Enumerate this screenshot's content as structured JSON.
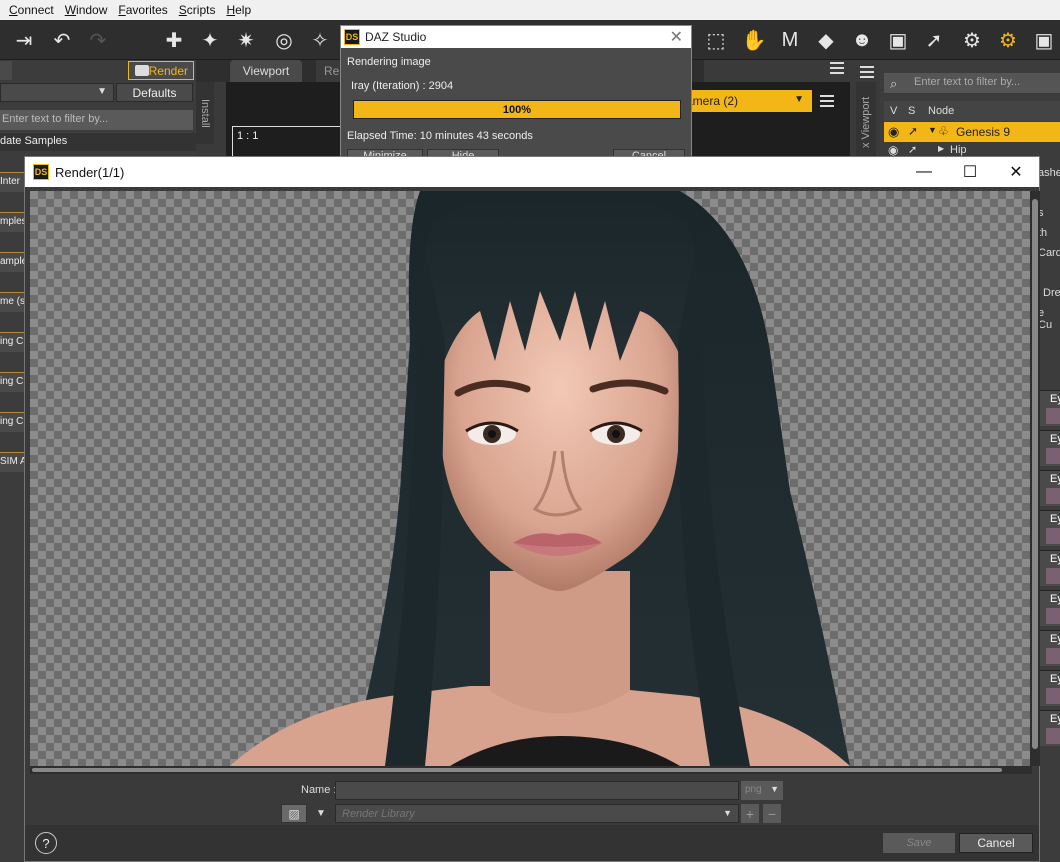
{
  "menu": [
    "Connect",
    "Window",
    "Favorites",
    "Scripts",
    "Help"
  ],
  "left_panel": {
    "render_button": "Render",
    "defaults_button": "Defaults",
    "filter_placeholder": "Enter text to filter by...",
    "section": "date Samples",
    "install_tab": "Install",
    "rows": [
      "Inter",
      "mples",
      "ample",
      "me (s",
      "ing C",
      "ing C",
      "ing C",
      "SIM A"
    ]
  },
  "viewport": {
    "tab": "Viewport",
    "tab2": "Re",
    "zoom": "1 : 1",
    "camera": "amera (2)"
  },
  "aux_viewport_tab": "x Viewport",
  "scene": {
    "filter_placeholder": "Enter text to filter by...",
    "col_v": "V",
    "col_s": "S",
    "col_node": "Node",
    "selected_node": "Genesis 9",
    "child_node": "Hip",
    "right_fragments": [
      "ashe",
      "s",
      "th",
      "Card",
      "Dre",
      "e Cu"
    ],
    "eye_rows": [
      "Ey",
      "Ey",
      "Ey",
      "Ey",
      "Ey",
      "Ey",
      "Ey",
      "Ey",
      "Ey"
    ]
  },
  "progress_dialog": {
    "title": "DAZ Studio",
    "status": "Rendering image",
    "iteration": "Iray (Iteration) : 2904",
    "progress_text": "100%",
    "progress_fraction": 1.0,
    "elapsed": "Elapsed Time:  10 minutes 43 seconds",
    "buttons": [
      "Minimize",
      "Hide",
      "Cancel"
    ]
  },
  "render_window": {
    "title": "Render(1/1)",
    "name_label": "Name :",
    "format": "png",
    "library_placeholder": "Render Library",
    "save_button": "Save",
    "cancel_button": "Cancel",
    "help_icon": "?"
  },
  "colors": {
    "accent": "#f2b617",
    "panel": "#3c3c3c",
    "dark": "#2e2e2e"
  }
}
